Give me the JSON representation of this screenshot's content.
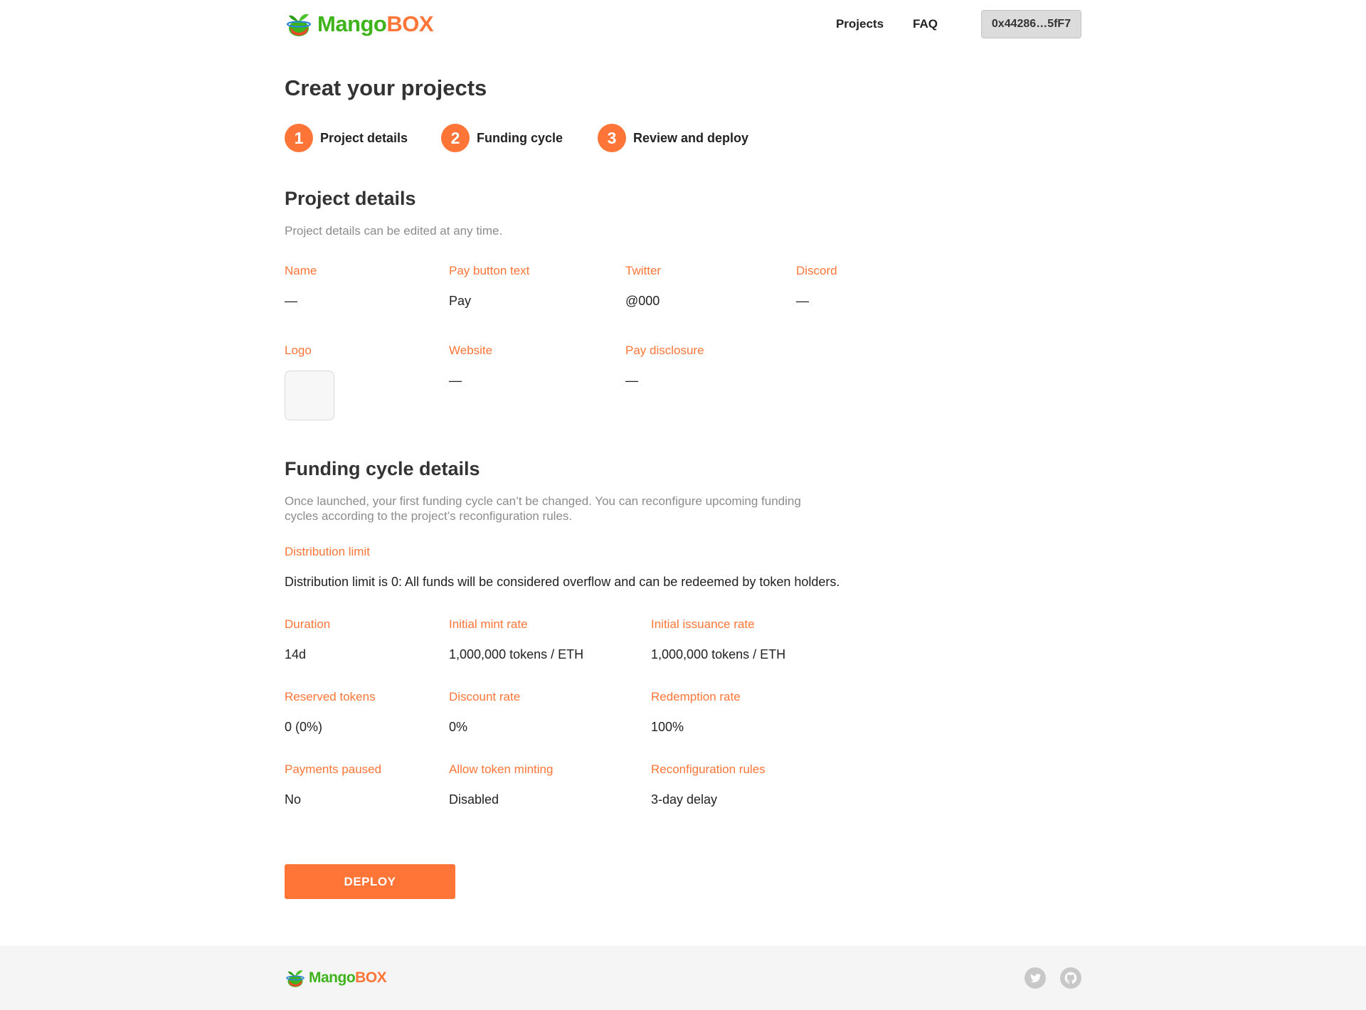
{
  "brand": {
    "name_part1": "Mango",
    "name_part2": "BOX"
  },
  "nav": {
    "projects": "Projects",
    "faq": "FAQ",
    "wallet": "0x44286…5fF7"
  },
  "page_title": "Creat your projects",
  "steps": [
    {
      "num": "1",
      "label": "Project details"
    },
    {
      "num": "2",
      "label": "Funding cycle"
    },
    {
      "num": "3",
      "label": "Review and deploy"
    }
  ],
  "project_details": {
    "title": "Project details",
    "desc": "Project details can be edited at any time.",
    "fields": {
      "name": {
        "label": "Name",
        "value": "—"
      },
      "pay_button": {
        "label": "Pay button text",
        "value": "Pay"
      },
      "twitter": {
        "label": "Twitter",
        "value": "@000"
      },
      "discord": {
        "label": "Discord",
        "value": "—"
      },
      "logo": {
        "label": "Logo"
      },
      "website": {
        "label": "Website",
        "value": "—"
      },
      "pay_disclosure": {
        "label": "Pay disclosure",
        "value": "—"
      }
    }
  },
  "funding_cycle": {
    "title": "Funding cycle details",
    "desc": "Once launched, your first funding cycle can’t be changed. You can reconfigure upcoming funding cycles according to the project’s reconfiguration rules.",
    "distribution_limit": {
      "label": "Distribution limit",
      "value": "Distribution limit is 0: All funds will be considered overflow and can be redeemed by token holders."
    },
    "fields": {
      "duration": {
        "label": "Duration",
        "value": "14d"
      },
      "initial_mint_rate": {
        "label": "Initial mint rate",
        "value": "1,000,000 tokens / ETH"
      },
      "initial_issuance_rate": {
        "label": "Initial issuance rate",
        "value": "1,000,000 tokens / ETH"
      },
      "reserved_tokens": {
        "label": "Reserved tokens",
        "value": "0 (0%)"
      },
      "discount_rate": {
        "label": "Discount rate",
        "value": "0%"
      },
      "redemption_rate": {
        "label": "Redemption rate",
        "value": "100%"
      },
      "payments_paused": {
        "label": "Payments paused",
        "value": "No"
      },
      "allow_token_minting": {
        "label": "Allow token minting",
        "value": "Disabled"
      },
      "reconfiguration_rules": {
        "label": "Reconfiguration rules",
        "value": "3-day delay"
      }
    }
  },
  "deploy_label": "DEPLOY",
  "footer": {
    "icons": [
      "twitter-icon",
      "github-icon"
    ]
  },
  "colors": {
    "accent": "#ff7537",
    "brand_green": "#3fb31c",
    "footer_bg": "#f5f5f5"
  }
}
